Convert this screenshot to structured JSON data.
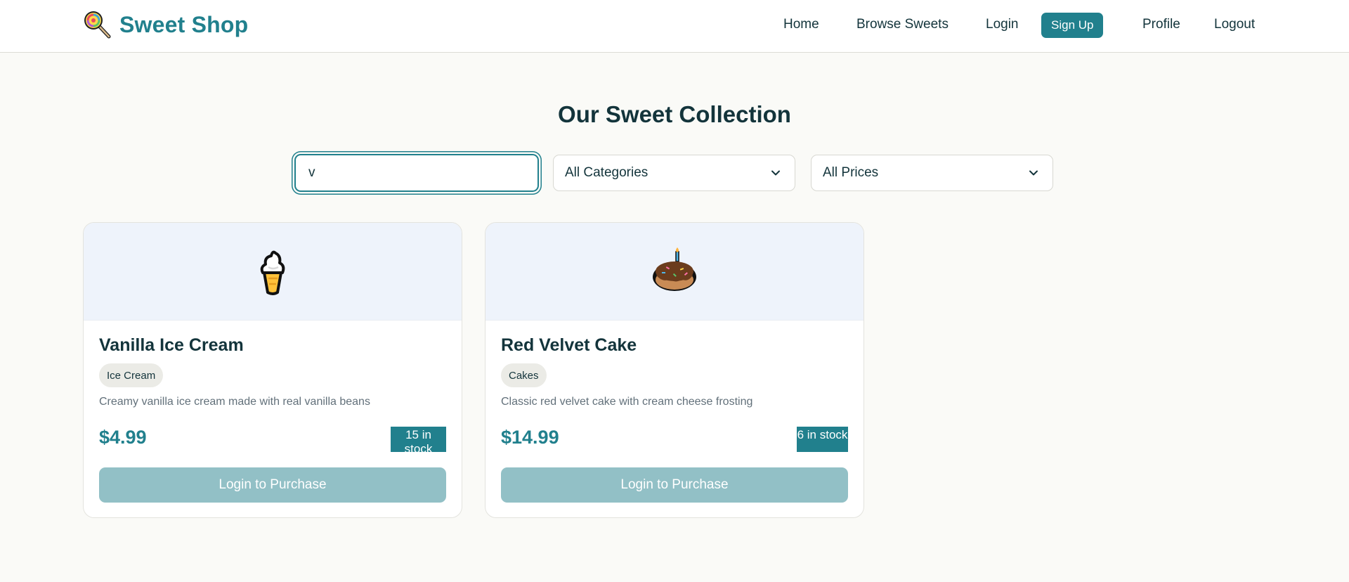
{
  "brand": {
    "name": "Sweet Shop",
    "icon": "lollipop-icon"
  },
  "nav": {
    "home": "Home",
    "browse": "Browse Sweets",
    "login": "Login",
    "signup": "Sign Up",
    "profile": "Profile",
    "logout": "Logout"
  },
  "page": {
    "title": "Our Sweet Collection"
  },
  "filters": {
    "search_value": "v",
    "category_selected": "All Categories",
    "price_selected": "All Prices"
  },
  "products": [
    {
      "icon": "ice-cream-icon",
      "name": "Vanilla Ice Cream",
      "category": "Ice Cream",
      "description": "Creamy vanilla ice cream made with real vanilla beans",
      "price": "$4.99",
      "stock": "15 in stock",
      "action": "Login to Purchase"
    },
    {
      "icon": "cake-icon",
      "name": "Red Velvet Cake",
      "category": "Cakes",
      "description": "Classic red velvet cake with cream cheese frosting",
      "price": "$14.99",
      "stock": "6 in stock",
      "action": "Login to Purchase"
    }
  ],
  "colors": {
    "accent": "#21808d",
    "accent_disabled": "#92c0c6",
    "background": "#fafaf7",
    "text": "#13343b",
    "card_media_bg": "#eef3fb"
  }
}
